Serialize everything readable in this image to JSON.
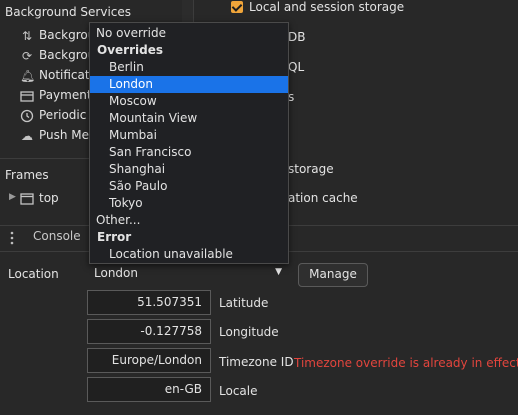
{
  "sidebar": {
    "section_background": "Background Services",
    "items": [
      {
        "label": "Background",
        "icon": "arrows-updown-icon"
      },
      {
        "label": "Background",
        "icon": "background-icon"
      },
      {
        "label": "Notifications",
        "icon": "bell-icon"
      },
      {
        "label": "Payment",
        "icon": "card-icon"
      },
      {
        "label": "Periodic B",
        "icon": "clock-icon"
      },
      {
        "label": "Push Mess",
        "icon": "cloud-icon"
      }
    ],
    "section_frames": "Frames",
    "frame_item": "top"
  },
  "right_panel": {
    "checkbox_label": "Local and session storage",
    "partial_1": "DB",
    "partial_2": "QL",
    "partial_3": "s",
    "partial_4": "storage",
    "partial_5": "ation cache"
  },
  "drawer": {
    "tab_console": "Console"
  },
  "sensors": {
    "location_label": "Location",
    "location_value": "London",
    "manage_button": "Manage",
    "latitude_value": "51.507351",
    "latitude_label": "Latitude",
    "longitude_value": "-0.127758",
    "longitude_label": "Longitude",
    "timezone_value": "Europe/London",
    "timezone_label": "Timezone ID",
    "timezone_error": "Timezone override is already in effect",
    "locale_value": "en-GB",
    "locale_label": "Locale"
  },
  "dropdown": {
    "no_override": "No override",
    "group_overrides": "Overrides",
    "options": [
      "Berlin",
      "London",
      "Moscow",
      "Mountain View",
      "Mumbai",
      "San Francisco",
      "Shanghai",
      "São Paulo",
      "Tokyo"
    ],
    "selected": "London",
    "other": "Other...",
    "group_error": "Error",
    "location_unavailable": "Location unavailable"
  },
  "colors": {
    "accent": "#f0a53a",
    "selection": "#1a73e8",
    "error": "#e2453d"
  }
}
